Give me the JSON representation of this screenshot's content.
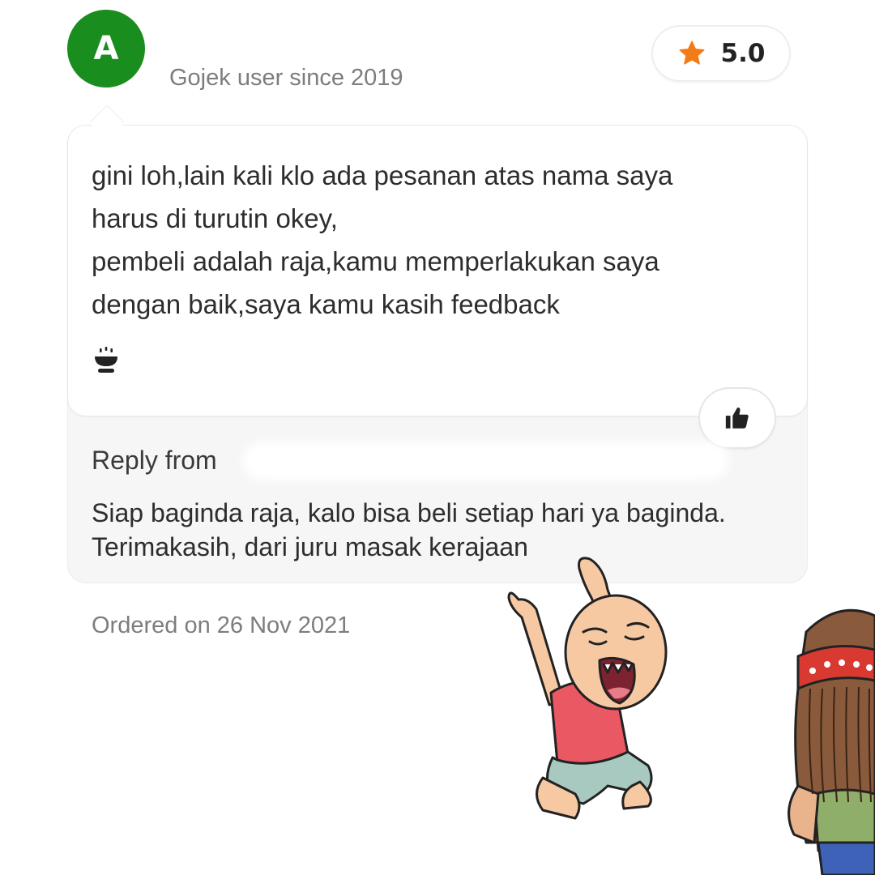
{
  "review": {
    "avatar_initial": "A",
    "user_since": "Gojek user since 2019",
    "rating": "5.0",
    "text_lines": [
      "gini loh,lain kali klo ada pesanan atas nama saya",
      "harus di turutin okey,",
      "pembeli adalah raja,kamu memperlakukan saya",
      "dengan baik,saya kamu kasih feedback"
    ],
    "tag_icon": "food-bowl-icon",
    "like_icon": "thumbs-up-icon"
  },
  "reply": {
    "label": "Reply from",
    "text_lines": [
      "Siap baginda raja, kalo bisa beli setiap hari ya baginda.",
      "Terimakasih, dari juru masak kerajaan"
    ]
  },
  "order": {
    "ordered_text": "Ordered on 26 Nov 2021"
  },
  "colors": {
    "avatar_bg": "#1a8d1f",
    "star": "#f27b16"
  }
}
